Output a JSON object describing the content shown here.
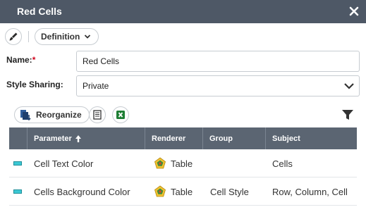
{
  "window": {
    "title": "Red Cells"
  },
  "toolbar": {
    "mode_label": "Definition"
  },
  "form": {
    "name_label": "Name:",
    "name_required_mark": "*",
    "name_value": "Red Cells",
    "sharing_label": "Style Sharing:",
    "sharing_value": "Private"
  },
  "actions": {
    "reorganize_label": "Reorganize"
  },
  "table": {
    "columns": [
      "Parameter",
      "Renderer",
      "Group",
      "Subject"
    ],
    "rows": [
      {
        "parameter": "Cell Text Color",
        "renderer": "Table",
        "group": "",
        "subject": "Cells"
      },
      {
        "parameter": "Cells Background Color",
        "renderer": "Table",
        "group": "Cell Style",
        "subject": "Row, Column, Cell"
      }
    ]
  },
  "colors": {
    "titlebar": "#4e5866",
    "header": "#5b6572",
    "swatch": "#3cc8d4",
    "required": "#d0021b"
  }
}
